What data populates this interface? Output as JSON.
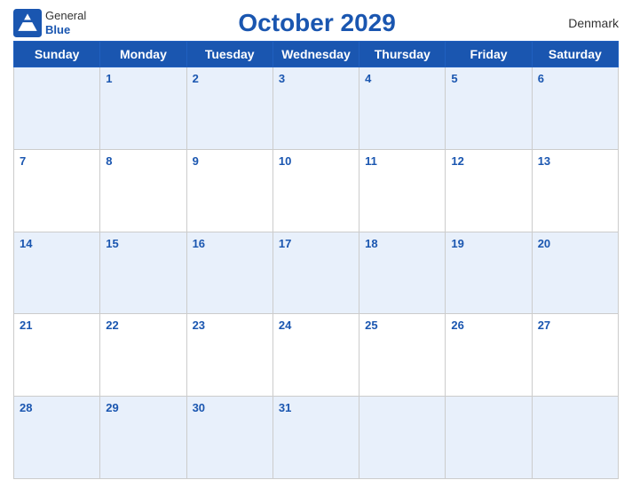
{
  "header": {
    "logo_line1": "General",
    "logo_line2": "Blue",
    "title": "October 2029",
    "country": "Denmark"
  },
  "weekdays": [
    "Sunday",
    "Monday",
    "Tuesday",
    "Wednesday",
    "Thursday",
    "Friday",
    "Saturday"
  ],
  "weeks": [
    [
      null,
      1,
      2,
      3,
      4,
      5,
      6
    ],
    [
      7,
      8,
      9,
      10,
      11,
      12,
      13
    ],
    [
      14,
      15,
      16,
      17,
      18,
      19,
      20
    ],
    [
      21,
      22,
      23,
      24,
      25,
      26,
      27
    ],
    [
      28,
      29,
      30,
      31,
      null,
      null,
      null
    ]
  ]
}
